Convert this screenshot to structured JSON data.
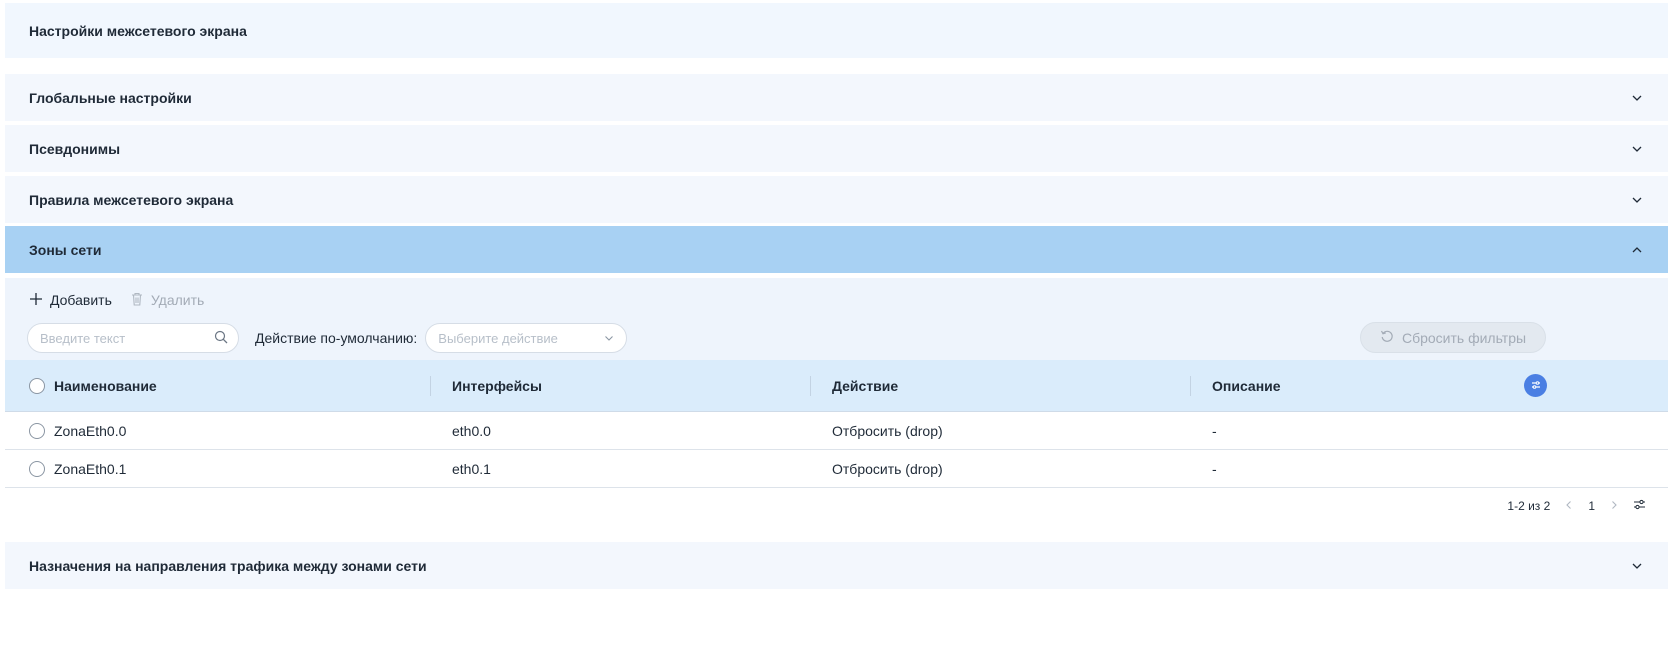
{
  "page": {
    "title": "Настройки межсетевого экрана"
  },
  "panels": [
    {
      "label": "Глобальные настройки",
      "expanded": false
    },
    {
      "label": "Псевдонимы",
      "expanded": false
    },
    {
      "label": "Правила межсетевого экрана",
      "expanded": false
    },
    {
      "label": "Зоны сети",
      "expanded": true
    },
    {
      "label": "Назначения на направления трафика между зонами сети",
      "expanded": false
    }
  ],
  "toolbar": {
    "add_label": "Добавить",
    "delete_label": "Удалить"
  },
  "filters": {
    "search_placeholder": "Введите текст",
    "default_action_label": "Действие по-умолчанию:",
    "default_action_placeholder": "Выберите действие",
    "reset_label": "Сбросить фильтры"
  },
  "table": {
    "columns": [
      "Наименование",
      "Интерфейсы",
      "Действие",
      "Описание"
    ],
    "rows": [
      {
        "name": "ZonaEth0.0",
        "interfaces": "eth0.0",
        "action": "Отбросить (drop)",
        "description": "-"
      },
      {
        "name": "ZonaEth0.1",
        "interfaces": "eth0.1",
        "action": "Отбросить (drop)",
        "description": "-"
      }
    ]
  },
  "pagination": {
    "range": "1-2 из 2",
    "current_page": "1"
  },
  "colors": {
    "active_panel": "#a8d1f3",
    "table_header": "#daecfb",
    "accent": "#4a7fe3"
  },
  "icons": [
    "chevron-down-icon",
    "chevron-up-icon",
    "plus-icon",
    "trash-icon",
    "search-icon",
    "reset-icon",
    "column-settings-icon",
    "chevron-left-icon",
    "chevron-right-icon",
    "sliders-icon"
  ]
}
